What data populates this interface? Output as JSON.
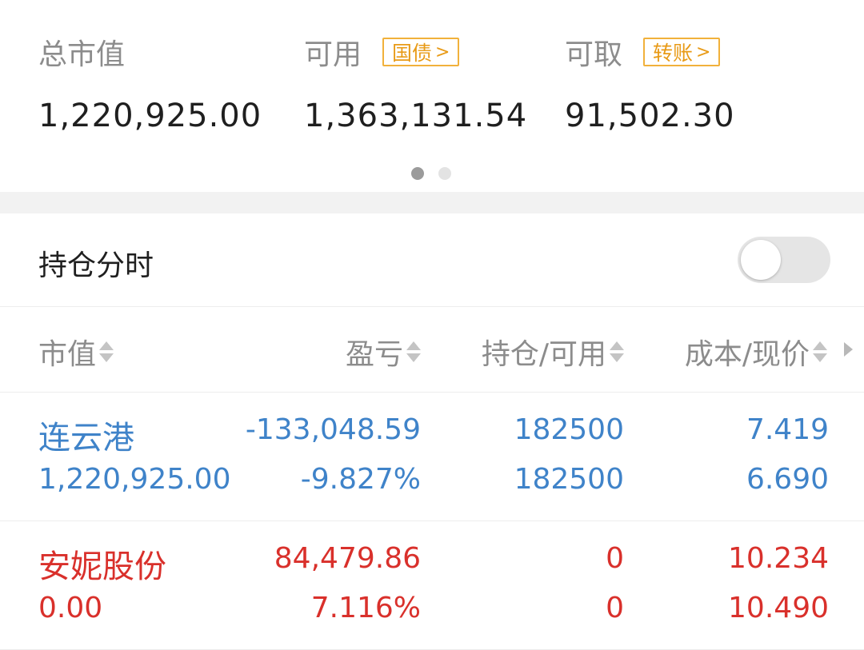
{
  "summary": {
    "stats": [
      {
        "label": "总市值",
        "value": "1,220,925.00"
      },
      {
        "label": "可用",
        "value": "1,363,131.54",
        "pill": "国债"
      },
      {
        "label": "可取",
        "value": "91,502.30",
        "pill": "转账"
      }
    ],
    "page_indicator": {
      "current": 1,
      "total": 2
    }
  },
  "timeshare": {
    "label": "持仓分时",
    "enabled": false
  },
  "table": {
    "headers": [
      "市值",
      "盈亏",
      "持仓/可用",
      "成本/现价"
    ],
    "rows": [
      {
        "name": "连云港",
        "market_value": "1,220,925.00",
        "pl": "-133,048.59",
        "pl_pct": "-9.827%",
        "position": "182500",
        "available": "182500",
        "cost": "7.419",
        "price": "6.690"
      },
      {
        "name": "安妮股份",
        "market_value": "0.00",
        "pl": "84,479.86",
        "pl_pct": "7.116%",
        "position": "0",
        "available": "0",
        "cost": "10.234",
        "price": "10.490"
      }
    ]
  },
  "colors": {
    "loss": "#3f83c9",
    "gain": "#d9302b",
    "pill": "#e89a16"
  }
}
